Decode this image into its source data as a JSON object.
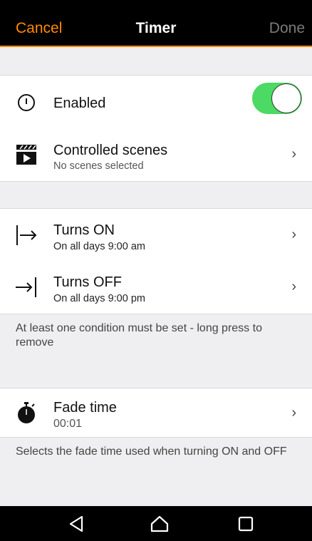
{
  "header": {
    "cancel": "Cancel",
    "title": "Timer",
    "done": "Done"
  },
  "enabled": {
    "label": "Enabled",
    "toggle_on": true,
    "accent": "#4cd964"
  },
  "scenes": {
    "label": "Controlled scenes",
    "sub": "No scenes selected",
    "chevron": "›"
  },
  "turns_on": {
    "label": "Turns ON",
    "sub": "On all days 9:00 am",
    "chevron": "›"
  },
  "turns_off": {
    "label": "Turns OFF",
    "sub": "On all days 9:00 pm",
    "chevron": "›"
  },
  "condition_note": "At least one condition must be set - long press to remove",
  "fade": {
    "label": "Fade time",
    "sub": "00:01",
    "chevron": "›"
  },
  "fade_note": "Selects the fade time used when turning ON and OFF",
  "colors": {
    "accent": "#ff8a00",
    "switch_on": "#4cd964"
  },
  "icons": [
    "power-icon",
    "clapperboard-icon",
    "turns-on-icon",
    "turns-off-icon",
    "stopwatch-icon",
    "back-icon",
    "home-icon",
    "recents-icon"
  ]
}
